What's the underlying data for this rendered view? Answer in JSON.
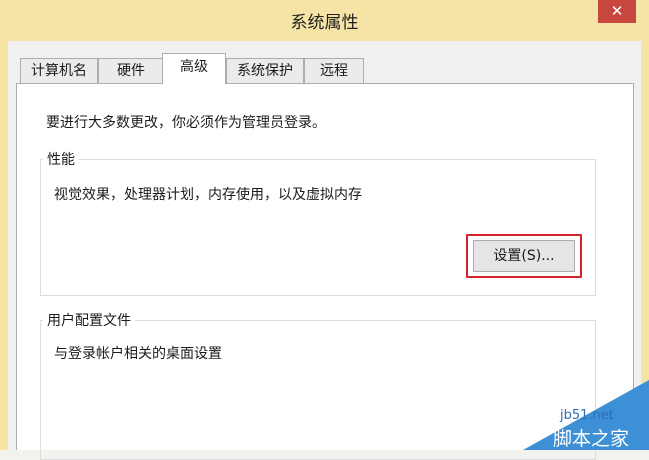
{
  "window": {
    "title": "系统属性",
    "close_glyph": "✕"
  },
  "tabs": [
    {
      "label": "计算机名",
      "active": false
    },
    {
      "label": "硬件",
      "active": false
    },
    {
      "label": "高级",
      "active": true
    },
    {
      "label": "系统保护",
      "active": false
    },
    {
      "label": "远程",
      "active": false
    }
  ],
  "advanced": {
    "admin_note": "要进行大多数更改，你必须作为管理员登录。",
    "performance": {
      "title": "性能",
      "description": "视觉效果，处理器计划，内存使用，以及虚拟内存",
      "settings_button": "设置(S)..."
    },
    "user_profiles": {
      "title": "用户配置文件",
      "description": "与登录帐户相关的桌面设置"
    }
  },
  "watermark": {
    "url": "jb51.net",
    "name": "脚本之家"
  },
  "colors": {
    "titlebar": "#f6e4a6",
    "close_button": "#c8483f",
    "highlight": "#d2262c",
    "watermark": "#3d8fd6"
  }
}
